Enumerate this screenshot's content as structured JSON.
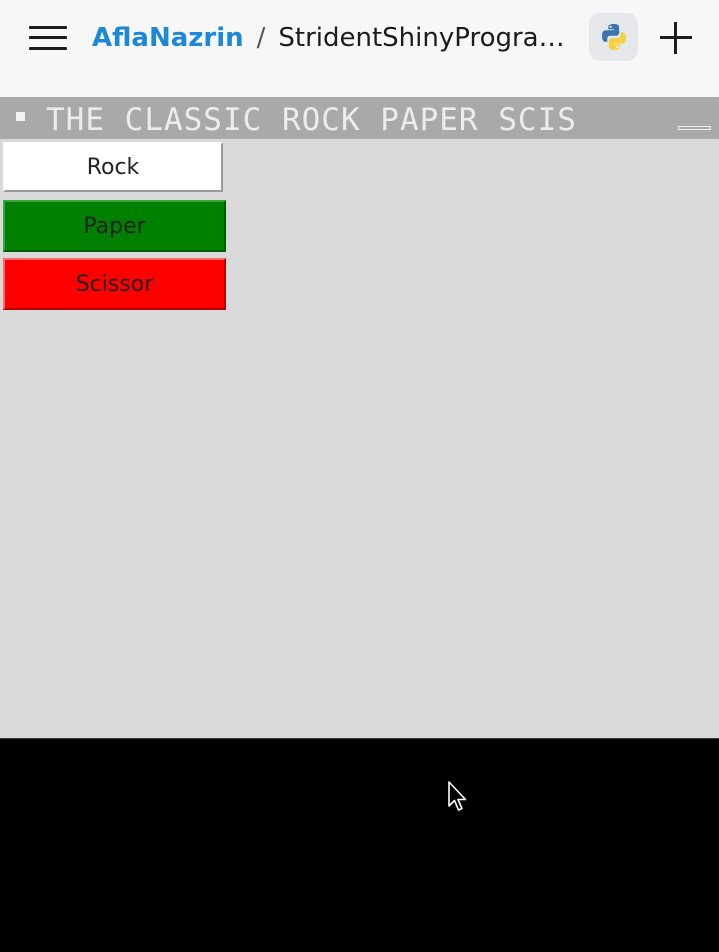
{
  "topbar": {
    "user": "AflaNazrin",
    "separator": "/",
    "repl_name": "StridentShinyProgram...",
    "language_icon": "python-logo-icon",
    "menu_icon": "hamburger-menu-icon",
    "add_icon": "plus-icon"
  },
  "tk_window": {
    "title": "THE CLASSIC ROCK PAPER SCIS",
    "menu_icon": "window-menu-icon",
    "minimize_icon": "minimize-icon",
    "background": "#d9d9d9",
    "buttons": [
      {
        "label": "Rock",
        "background": "#ffffff"
      },
      {
        "label": "Paper",
        "background": "#008000"
      },
      {
        "label": "Scissor",
        "background": "#ff0000"
      }
    ]
  },
  "console": {
    "background": "#000000",
    "pointer_icon": "mouse-pointer-icon"
  },
  "colors": {
    "accent": "#1e88d6",
    "titlebar": "#a9a9a9"
  }
}
